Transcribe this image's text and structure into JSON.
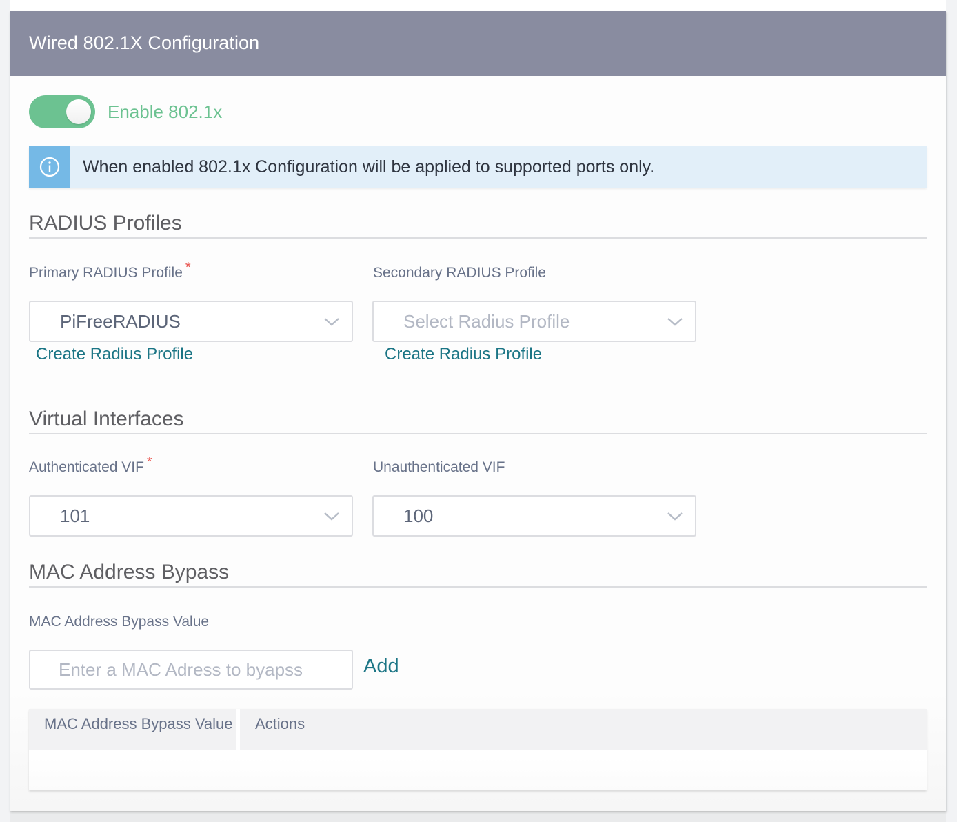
{
  "panel": {
    "title": "Wired 802.1X Configuration"
  },
  "enable_toggle": {
    "label": "Enable 802.1x",
    "checked": true,
    "color": "#6cc291"
  },
  "info_banner": {
    "icon": "info-icon",
    "text": "When enabled 802.1x Configuration will be applied to supported ports only."
  },
  "radius_profiles": {
    "title": "RADIUS Profiles",
    "primary": {
      "label": "Primary RADIUS Profile",
      "required": "*",
      "value": "PiFreeRADIUS",
      "create_link": "Create Radius Profile"
    },
    "secondary": {
      "label": "Secondary RADIUS Profile",
      "placeholder": "Select Radius Profile",
      "create_link": "Create Radius Profile"
    }
  },
  "virtual_interfaces": {
    "title": "Virtual Interfaces",
    "authenticated": {
      "label": "Authenticated VIF",
      "required": "*",
      "value": "101"
    },
    "unauthenticated": {
      "label": "Unauthenticated VIF",
      "value": "100"
    }
  },
  "mac_bypass": {
    "title": "MAC Address Bypass",
    "field_label": "MAC Address Bypass Value",
    "input_placeholder": "Enter a MAC Adress to byapss",
    "input_value": "",
    "add_label": "Add",
    "table": {
      "columns": [
        "MAC Address Bypass Value",
        "Actions"
      ],
      "rows": []
    }
  },
  "colors": {
    "header_bg": "#898ca0",
    "accent_green": "#6cc291",
    "link_teal": "#1b7585",
    "info_bg": "#e2eff9",
    "info_icon_bg": "#75b9e6",
    "required": "#e8504a"
  }
}
